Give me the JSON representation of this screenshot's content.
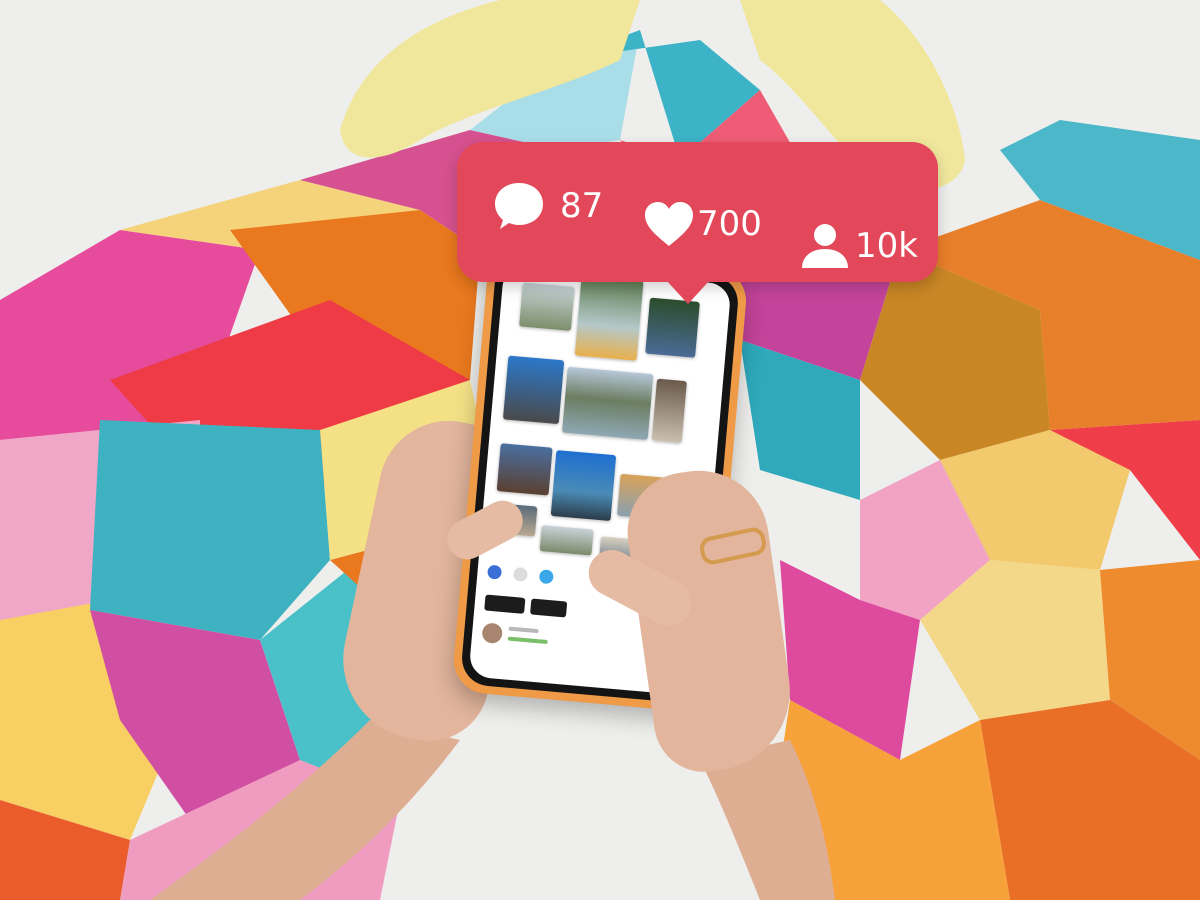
{
  "notification": {
    "comments": "87",
    "likes": "700",
    "followers": "10k",
    "icons": [
      "speech-bubble-icon",
      "heart-icon",
      "person-icon"
    ],
    "color": "#e2485a"
  },
  "phone": {
    "case_color": "#ef9a47"
  }
}
